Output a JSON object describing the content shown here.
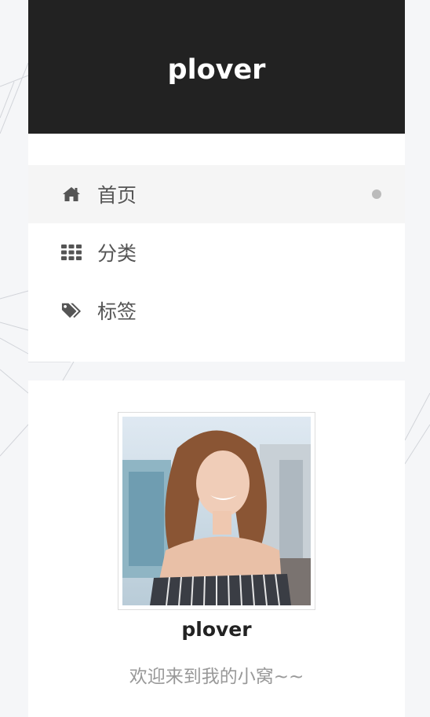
{
  "header": {
    "site_title": "plover"
  },
  "menu": {
    "items": [
      {
        "label": "首页",
        "icon": "home-icon",
        "active": true
      },
      {
        "label": "分类",
        "icon": "grid-icon",
        "active": false
      },
      {
        "label": "标签",
        "icon": "tags-icon",
        "active": false
      }
    ]
  },
  "sidebar": {
    "author_name": "plover",
    "motto": "欢迎来到我的小窝~~"
  },
  "colors": {
    "header_bg": "#222222",
    "page_bg": "#f5f6f8",
    "active_item_bg": "#f5f5f5",
    "active_dot": "#bbbbbb"
  }
}
